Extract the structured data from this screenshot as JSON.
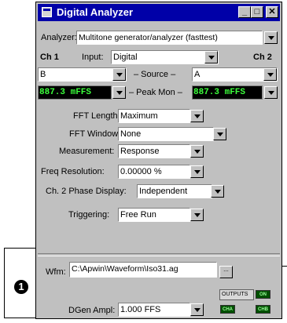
{
  "window": {
    "title": "Digital Analyzer"
  },
  "titlebar": {
    "minimize": "_",
    "maximize": "□",
    "close": "✕"
  },
  "analyzer": {
    "label": "Analyzer:",
    "value": "Multitone generator/analyzer (fasttest)"
  },
  "channels": {
    "ch1": "Ch 1",
    "ch2": "Ch 2",
    "input_label": "Input:",
    "input_value": "Digital",
    "source_label": "– Source –",
    "ch1_source": "B",
    "ch2_source": "A",
    "peak_label": "– Peak Mon –",
    "ch1_peak": "887.3  mFFS",
    "ch2_peak": "887.3  mFFS"
  },
  "settings": {
    "fft_length_label": "FFT Length:",
    "fft_length": "Maximum",
    "fft_window_label": "FFT Window:",
    "fft_window": "None",
    "measurement_label": "Measurement:",
    "measurement": "Response",
    "freq_res_label": "Freq Resolution:",
    "freq_res": "0.00000  %",
    "phase_label": "Ch. 2 Phase Display:",
    "phase": "Independent",
    "trigger_label": "Triggering:",
    "trigger": "Free Run"
  },
  "generator": {
    "wfm_label": "Wfm:",
    "wfm_value": "C:\\Apwin\\Waveform\\Iso31.ag",
    "browse": "...",
    "outputs_label": "OUTPUTS",
    "outputs_state": "ON",
    "dgen_label": "DGen Ampl:",
    "dgen_value": "1.000   FFS",
    "cha": "CHA",
    "chb": "CHB"
  },
  "callout": {
    "number": "1"
  }
}
